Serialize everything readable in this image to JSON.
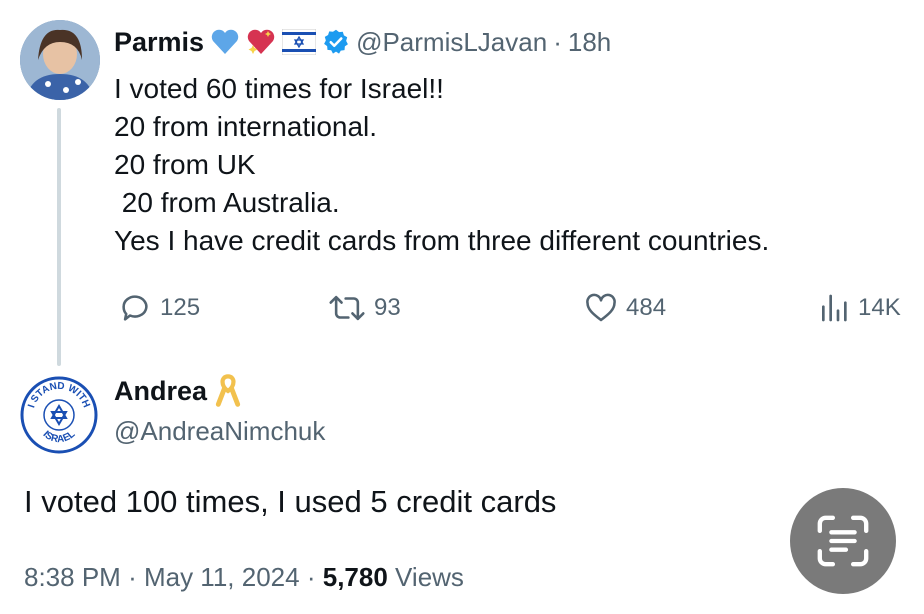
{
  "tweet": {
    "author_name": "Parmis",
    "handle": "@ParmisLJavan",
    "separator": "·",
    "time_ago": "18h",
    "lines": [
      "I voted 60 times for Israel!!",
      "20 from international.",
      "20 from UK",
      " 20 from Australia.",
      "Yes I have credit cards from three different countries."
    ],
    "replies": "125",
    "reposts": "93",
    "likes": "484",
    "views": "14K"
  },
  "reply": {
    "author_name": "Andrea",
    "handle": "@AndreaNimchuk",
    "text": "I voted 100 times, I used 5 credit cards",
    "time": "8:38 PM",
    "date": "May 11, 2024",
    "separator": "·",
    "views_count": "5,780",
    "views_label": "Views",
    "avatar_text_top": "I STAND WITH",
    "avatar_text_bottom": "ISRAEL"
  },
  "icons": {
    "verified": "verified-badge-icon",
    "reply": "reply-icon",
    "repost": "repost-icon",
    "like": "heart-icon",
    "views": "views-icon",
    "scan": "text-scan-icon"
  },
  "colors": {
    "verified_blue": "#1d9bf0",
    "muted": "#536471",
    "text": "#0f1419",
    "ribbon": "#f2c14e",
    "scan_button": "#7a7a7a"
  }
}
